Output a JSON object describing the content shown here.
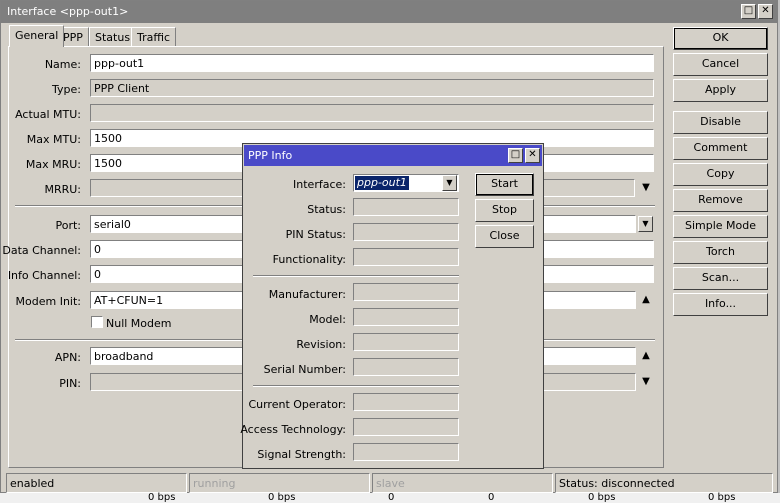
{
  "window": {
    "title": "Interface <ppp-out1>",
    "restore_glyph": "□",
    "close_glyph": "✕"
  },
  "tabs": [
    {
      "label": "General",
      "active": true
    },
    {
      "label": "PPP",
      "active": false
    },
    {
      "label": "Status",
      "active": false
    },
    {
      "label": "Traffic",
      "active": false
    }
  ],
  "form": {
    "name": {
      "label": "Name:",
      "value": "ppp-out1"
    },
    "type": {
      "label": "Type:",
      "value": "PPP Client"
    },
    "actual_mtu": {
      "label": "Actual MTU:",
      "value": ""
    },
    "max_mtu": {
      "label": "Max MTU:",
      "value": "1500"
    },
    "max_mru": {
      "label": "Max MRU:",
      "value": "1500"
    },
    "mrru": {
      "label": "MRRU:",
      "value": ""
    },
    "port": {
      "label": "Port:",
      "value": "serial0"
    },
    "data_channel": {
      "label": "Data Channel:",
      "value": "0"
    },
    "info_channel": {
      "label": "Info Channel:",
      "value": "0"
    },
    "modem_init": {
      "label": "Modem Init:",
      "value": "AT+CFUN=1"
    },
    "null_modem": {
      "label": "Null Modem",
      "checked": false
    },
    "apn": {
      "label": "APN:",
      "value": "broadband"
    },
    "pin": {
      "label": "PIN:",
      "value": ""
    }
  },
  "buttons": [
    {
      "label": "OK",
      "name": "ok-button"
    },
    {
      "label": "Cancel",
      "name": "cancel-button"
    },
    {
      "label": "Apply",
      "name": "apply-button"
    },
    {
      "label": "Disable",
      "name": "disable-button"
    },
    {
      "label": "Comment",
      "name": "comment-button"
    },
    {
      "label": "Copy",
      "name": "copy-button"
    },
    {
      "label": "Remove",
      "name": "remove-button"
    },
    {
      "label": "Simple Mode",
      "name": "simple-mode-button"
    },
    {
      "label": "Torch",
      "name": "torch-button"
    },
    {
      "label": "Scan...",
      "name": "scan-button"
    },
    {
      "label": "Info...",
      "name": "info-button"
    }
  ],
  "statusbar": {
    "state": "enabled",
    "running": "running",
    "slave": "slave",
    "status": "Status: disconnected"
  },
  "background_row": [
    "0 bps",
    "0 bps",
    "0",
    "0",
    "0 bps",
    "0 bps"
  ],
  "dialog": {
    "title": "PPP Info",
    "interface": {
      "label": "Interface:",
      "value": "ppp-out1"
    },
    "status": {
      "label": "Status:",
      "value": ""
    },
    "pin_status": {
      "label": "PIN Status:",
      "value": ""
    },
    "functionality": {
      "label": "Functionality:",
      "value": ""
    },
    "manufacturer": {
      "label": "Manufacturer:",
      "value": ""
    },
    "model": {
      "label": "Model:",
      "value": ""
    },
    "revision": {
      "label": "Revision:",
      "value": ""
    },
    "serial_number": {
      "label": "Serial Number:",
      "value": ""
    },
    "current_operator": {
      "label": "Current Operator:",
      "value": ""
    },
    "access_technology": {
      "label": "Access Technology:",
      "value": ""
    },
    "signal_strength": {
      "label": "Signal Strength:",
      "value": ""
    },
    "start_label": "Start",
    "stop_label": "Stop",
    "close_label": "Close"
  },
  "icons": {
    "dropdown": "▼",
    "up": "▲",
    "down": "▼",
    "combo": "▾"
  }
}
